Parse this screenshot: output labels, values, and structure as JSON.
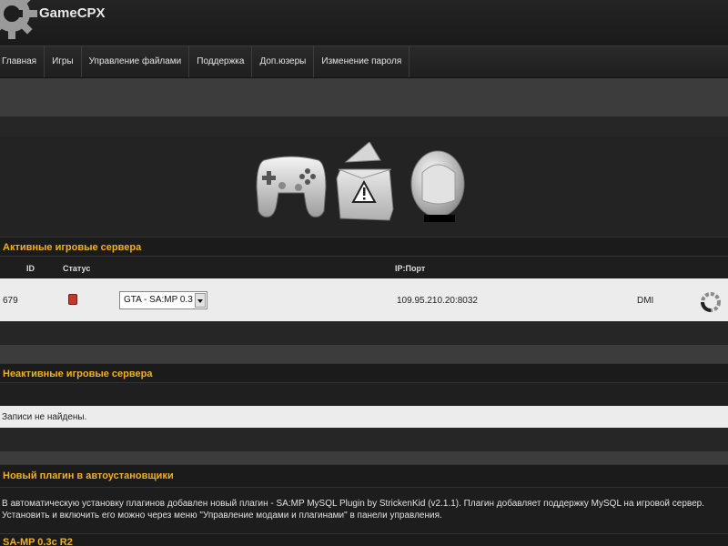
{
  "app": {
    "name": "GameCPX"
  },
  "nav": {
    "items": [
      {
        "label": "Главная"
      },
      {
        "label": "Игры"
      },
      {
        "label": "Управление файлами"
      },
      {
        "label": "Поддержка"
      },
      {
        "label": "Доп.юзеры"
      },
      {
        "label": "Изменение пароля"
      }
    ]
  },
  "icons": [
    "gamepad-icon",
    "warning-icon",
    "helmet-icon"
  ],
  "active_servers": {
    "title": "Активные игровые сервера",
    "columns": {
      "id": "ID",
      "status": "Статус",
      "ip_port": "IP:Порт"
    },
    "rows": [
      {
        "id": "679",
        "status_color": "#c0392b",
        "game": "GTA - SA:MP 0.3",
        "ip_port": "109.95.210.20:8032",
        "name": "DMI"
      }
    ]
  },
  "inactive_servers": {
    "title": "Неактивные игровые сервера",
    "empty_text": "Записи не найдены."
  },
  "news": {
    "title": "Новый плагин в автоустановщики",
    "body": "В автоматическую установку плагинов добавлен новый плагин - SA:MP MySQL Plugin by StrickenKid (v2.1.1). Плагин добавляет поддержку MySQL на игровой сервер. Установить и включить его можно через меню \"Управление модами и плагинами\" в панели управления.",
    "next_title": "SA-MP 0.3c R2"
  },
  "colors": {
    "accent": "#f0b020",
    "status_stopped": "#c0392b"
  }
}
